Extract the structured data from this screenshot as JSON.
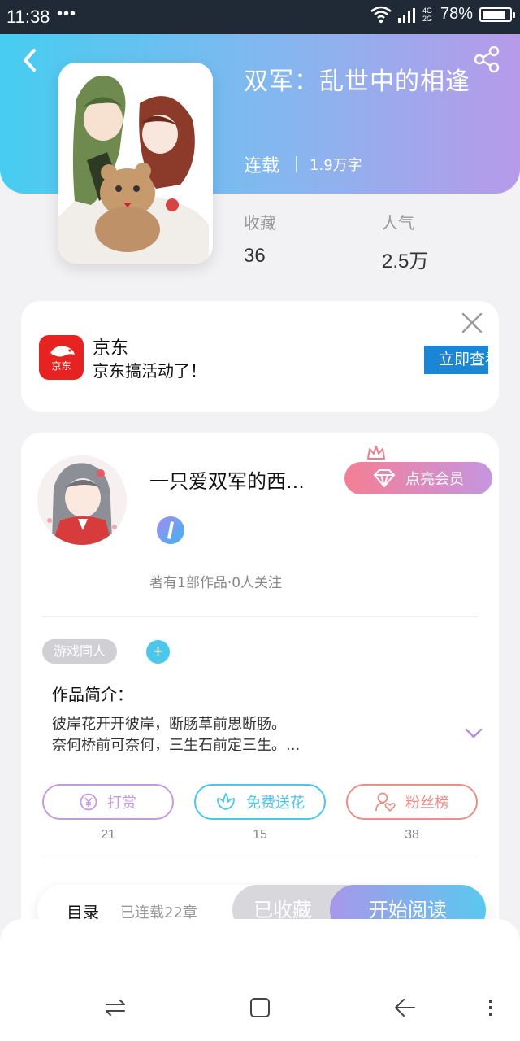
{
  "status_bar": {
    "time": "11:38",
    "dots": "•••",
    "net_top": "4G",
    "net_bottom": "2G",
    "battery_pct": "78%"
  },
  "book": {
    "title": "双军：乱世中的相逢",
    "status": "连载",
    "word_count": "1.9万字",
    "stats": [
      {
        "label": "收藏",
        "value": "36"
      },
      {
        "label": "人气",
        "value": "2.5万"
      }
    ]
  },
  "ad": {
    "brand": "京东",
    "logo_text": "京东",
    "text": "京东搞活动了！",
    "cta": "立即查看"
  },
  "author": {
    "name": "一只爱双军的西...",
    "stats_line": "著有1部作品·0人关注",
    "vip_button": "点亮会员"
  },
  "tags": [
    {
      "label": "游戏同人"
    }
  ],
  "tag_add": "+",
  "intro": {
    "title": "作品简介：",
    "line1": "彼岸花开开彼岸，断肠草前思断肠。",
    "line2": "奈何桥前可奈何，三生石前定三生。..."
  },
  "actions": [
    {
      "label": "打赏",
      "count": "21",
      "color": "#c59ae2"
    },
    {
      "label": "免费送花",
      "count": "15",
      "color": "#4ac8ec"
    },
    {
      "label": "粉丝榜",
      "count": "38",
      "color": "#ee8c86"
    }
  ],
  "bottom_bar": {
    "toc": "目录",
    "chapters": "已连载22章",
    "collected": "已收藏",
    "read": "开始阅读"
  },
  "colors": {
    "header_start": "#46cdf1",
    "header_end": "#b79ae9",
    "ad_red": "#e62321",
    "cta_blue": "#1a86d4"
  }
}
